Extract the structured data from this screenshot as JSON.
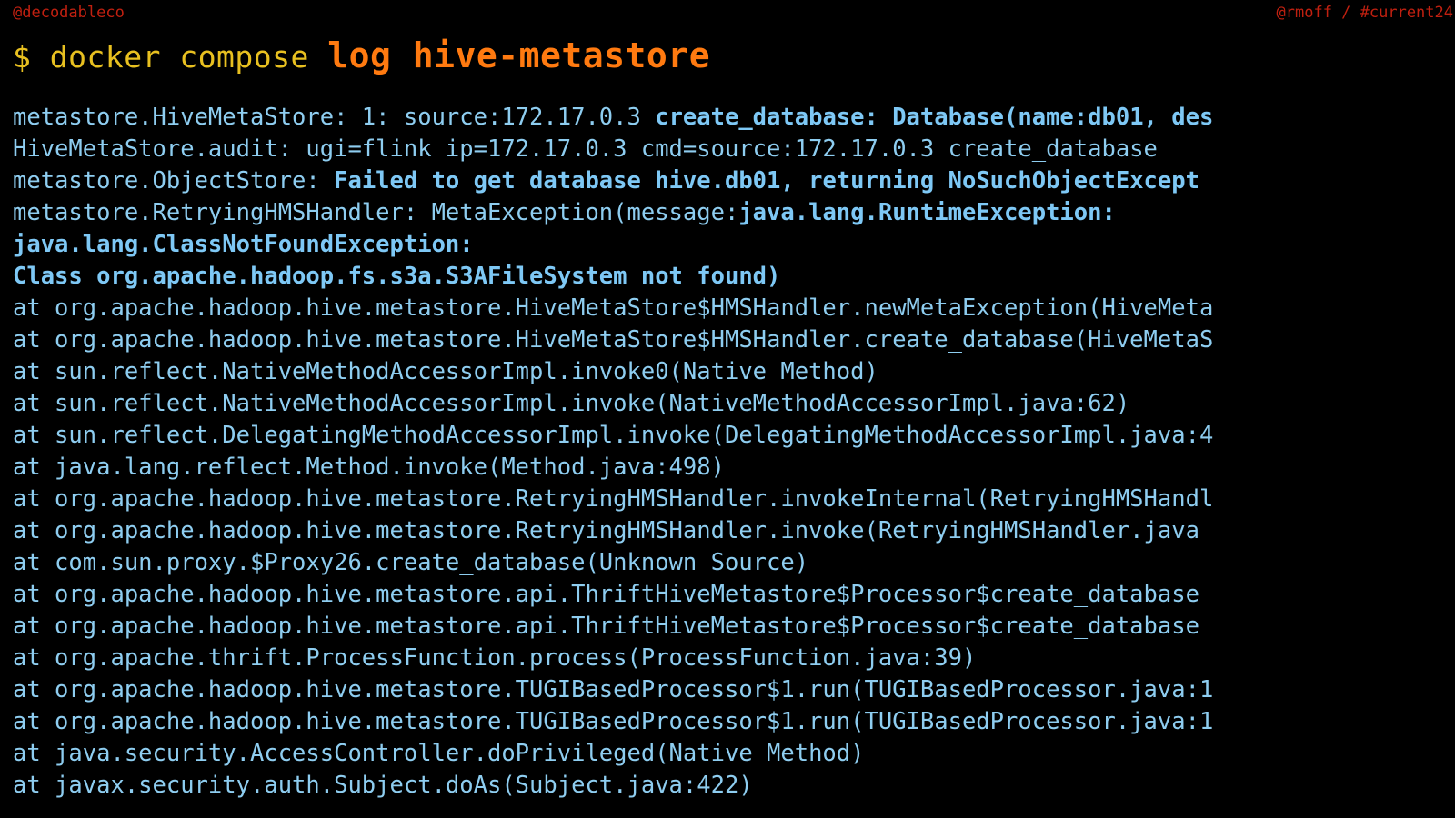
{
  "header": {
    "credit_left": "@decodableco",
    "credit_right": "@rmoff / #current24"
  },
  "title": {
    "prompt": "$ ",
    "command": "docker compose ",
    "emphasis": "log hive-metastore"
  },
  "colors": {
    "background": "#000000",
    "credit_red": "#c02010",
    "prompt_yellow": "#e8c020",
    "emphasis_orange": "#ff7a10",
    "log_blue": "#8ecdf0",
    "log_blue_bold": "#7ec8f5"
  },
  "log": {
    "lines": [
      {
        "segments": [
          {
            "text": "metastore.HiveMetaStore: 1: source:172.17.0.3 ",
            "bold": false
          },
          {
            "text": "create_database: Database(name:db01, des",
            "bold": true
          }
        ]
      },
      {
        "segments": [
          {
            "text": "HiveMetaStore.audit: ugi=flink   ip=172.17.0.3   cmd=source:172.17.0.3 create_database",
            "bold": false
          }
        ]
      },
      {
        "segments": [
          {
            "text": "metastore.ObjectStore: ",
            "bold": false
          },
          {
            "text": "Failed to get database hive.db01, returning NoSuchObjectExcept",
            "bold": true
          }
        ]
      },
      {
        "segments": [
          {
            "text": "metastore.RetryingHMSHandler: MetaException(message:",
            "bold": false
          },
          {
            "text": "java.lang.RuntimeException:",
            "bold": true
          }
        ]
      },
      {
        "segments": [
          {
            "text": "java.lang.ClassNotFoundException:",
            "bold": true
          }
        ]
      },
      {
        "segments": [
          {
            "text": "Class org.apache.hadoop.fs.s3a.S3AFileSystem not found)",
            "bold": true
          }
        ]
      },
      {
        "segments": [
          {
            "text": "at org.apache.hadoop.hive.metastore.HiveMetaStore$HMSHandler.newMetaException(HiveMeta",
            "bold": false
          }
        ]
      },
      {
        "segments": [
          {
            "text": "at org.apache.hadoop.hive.metastore.HiveMetaStore$HMSHandler.create_database(HiveMetaS",
            "bold": false
          }
        ]
      },
      {
        "segments": [
          {
            "text": "at sun.reflect.NativeMethodAccessorImpl.invoke0(Native Method)",
            "bold": false
          }
        ]
      },
      {
        "segments": [
          {
            "text": "at sun.reflect.NativeMethodAccessorImpl.invoke(NativeMethodAccessorImpl.java:62)",
            "bold": false
          }
        ]
      },
      {
        "segments": [
          {
            "text": "at sun.reflect.DelegatingMethodAccessorImpl.invoke(DelegatingMethodAccessorImpl.java:4",
            "bold": false
          }
        ]
      },
      {
        "segments": [
          {
            "text": "at java.lang.reflect.Method.invoke(Method.java:498)",
            "bold": false
          }
        ]
      },
      {
        "segments": [
          {
            "text": "at org.apache.hadoop.hive.metastore.RetryingHMSHandler.invokeInternal(RetryingHMSHandl",
            "bold": false
          }
        ]
      },
      {
        "segments": [
          {
            "text": "at org.apache.hadoop.hive.metastore.RetryingHMSHandler.invoke(RetryingHMSHandler.java",
            "bold": false
          }
        ]
      },
      {
        "segments": [
          {
            "text": "at com.sun.proxy.$Proxy26.create_database(Unknown Source)",
            "bold": false
          }
        ]
      },
      {
        "segments": [
          {
            "text": "at org.apache.hadoop.hive.metastore.api.ThriftHiveMetastore$Processor$create_database",
            "bold": false
          }
        ]
      },
      {
        "segments": [
          {
            "text": "at org.apache.hadoop.hive.metastore.api.ThriftHiveMetastore$Processor$create_database",
            "bold": false
          }
        ]
      },
      {
        "segments": [
          {
            "text": "at org.apache.thrift.ProcessFunction.process(ProcessFunction.java:39)",
            "bold": false
          }
        ]
      },
      {
        "segments": [
          {
            "text": "at org.apache.hadoop.hive.metastore.TUGIBasedProcessor$1.run(TUGIBasedProcessor.java:1",
            "bold": false
          }
        ]
      },
      {
        "segments": [
          {
            "text": "at org.apache.hadoop.hive.metastore.TUGIBasedProcessor$1.run(TUGIBasedProcessor.java:1",
            "bold": false
          }
        ]
      },
      {
        "segments": [
          {
            "text": "at java.security.AccessController.doPrivileged(Native Method)",
            "bold": false
          }
        ]
      },
      {
        "segments": [
          {
            "text": "at javax.security.auth.Subject.doAs(Subject.java:422)",
            "bold": false
          }
        ]
      }
    ]
  }
}
